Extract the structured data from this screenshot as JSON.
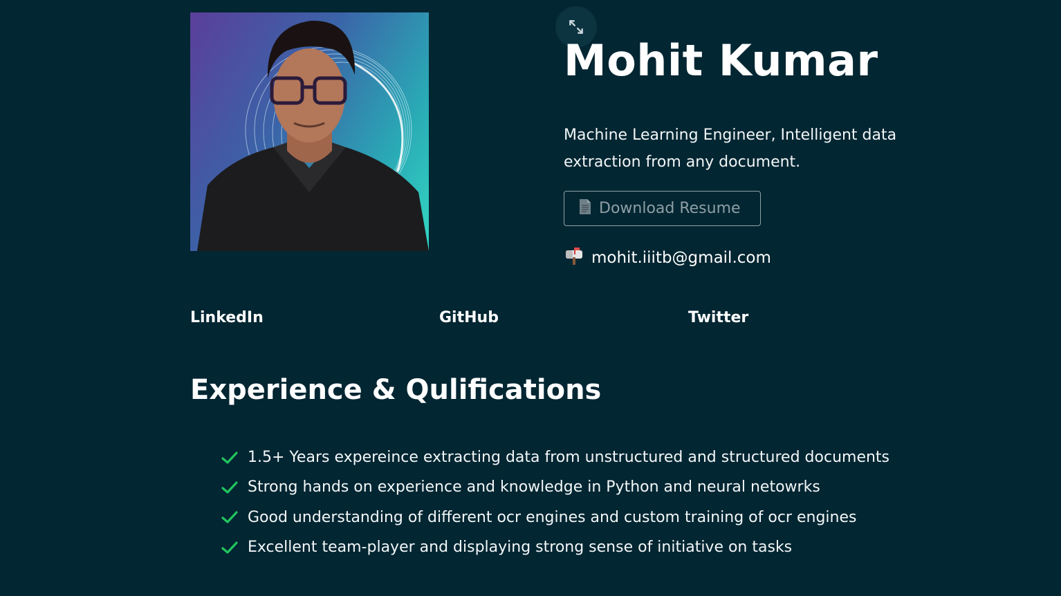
{
  "profile": {
    "name": "Mohit Kumar",
    "subtitle": "Machine Learning Engineer, Intelligent data extraction from any document.",
    "resume_button_label": "Download Resume",
    "email": "mohit.iiitb@gmail.com"
  },
  "social_links": [
    {
      "label": "LinkedIn"
    },
    {
      "label": "GitHub"
    },
    {
      "label": "Twitter"
    }
  ],
  "qualifications": {
    "title": "Experience & Qulifications",
    "items": [
      "1.5+ Years expereince extracting data from unstructured and structured documents",
      "Strong hands on experience and knowledge in Python and neural netowrks",
      "Good understanding of different ocr engines and custom training of ocr engines",
      "Excellent team-player and displaying strong sense of initiative on tasks"
    ]
  },
  "icons": {
    "resume": "document-icon",
    "email": "mailbox-icon",
    "check": "check-icon",
    "expand": "expand-icon"
  },
  "colors": {
    "background": "#022632",
    "text": "#ffffff",
    "check": "#22c55e",
    "button_border": "#8fa3aa"
  }
}
